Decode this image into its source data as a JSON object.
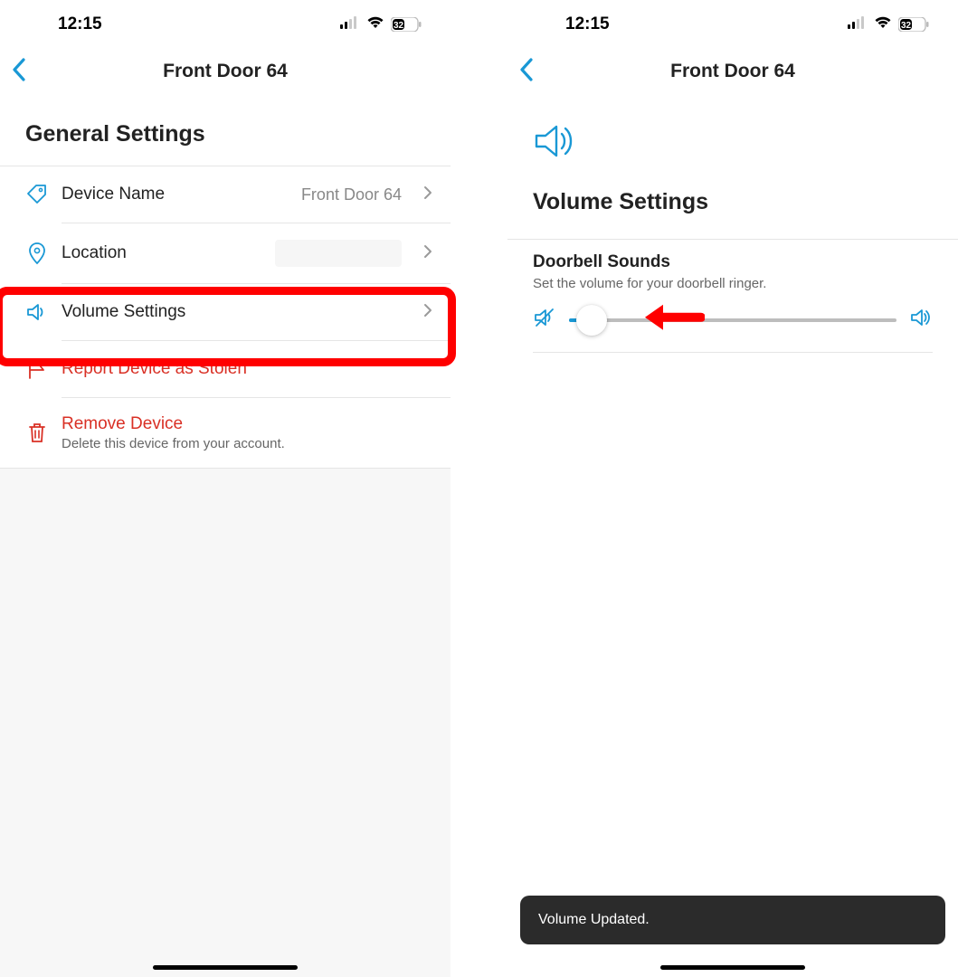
{
  "status": {
    "time": "12:15",
    "battery": "32"
  },
  "screen1": {
    "header_title": "Front Door 64",
    "section_title": "General Settings",
    "device_name": {
      "label": "Device Name",
      "value": "Front Door 64"
    },
    "location": {
      "label": "Location"
    },
    "volume": {
      "label": "Volume Settings"
    },
    "report": {
      "label": "Report Device as Stolen"
    },
    "remove": {
      "label": "Remove Device",
      "sub": "Delete this device from your account."
    }
  },
  "screen2": {
    "header_title": "Front Door 64",
    "volume_title": "Volume Settings",
    "doorbell": {
      "title": "Doorbell Sounds",
      "sub": "Set the volume for your doorbell ringer."
    },
    "slider_percent": 7,
    "toast": "Volume Updated."
  },
  "colors": {
    "accent": "#1998d5",
    "danger": "#d93025"
  }
}
